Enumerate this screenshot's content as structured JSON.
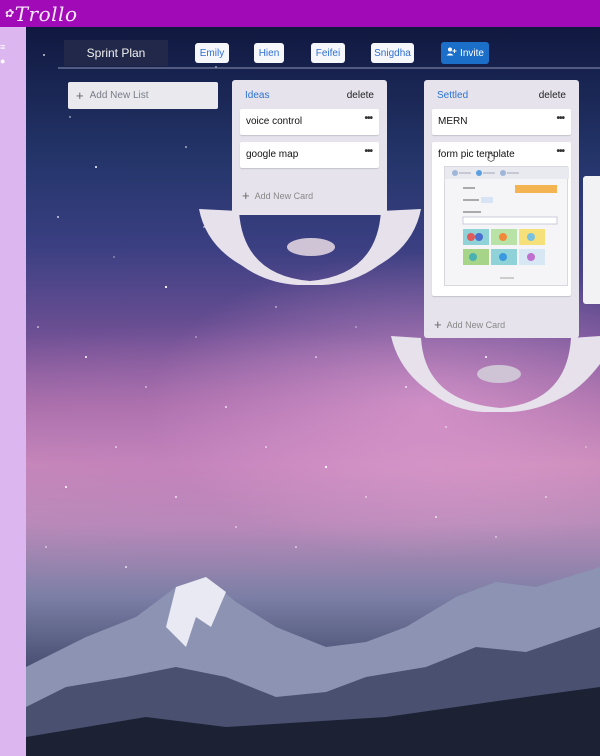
{
  "app": {
    "brand": "Trollo"
  },
  "board": {
    "title": "Sprint Plan",
    "members": [
      "Emily",
      "Hien",
      "Feifei",
      "Snigdha"
    ],
    "invite_label": "Invite",
    "add_list_label": "Add New List"
  },
  "lists": [
    {
      "title": "Ideas",
      "delete_label": "delete",
      "cards": [
        {
          "title": "voice control",
          "menu": "•••"
        },
        {
          "title": "google map",
          "menu": "•••"
        }
      ],
      "add_card_label": "Add New Card"
    },
    {
      "title": "Settled",
      "delete_label": "delete",
      "cards": [
        {
          "title": "MERN",
          "menu": "•••"
        },
        {
          "title": "form pic template",
          "menu": "•••"
        }
      ],
      "add_card_label": "Add New Card"
    }
  ],
  "colors": {
    "topbar": "#a10ab7",
    "sidebar": "#dcb6ee",
    "accent_blue": "#2c73d2",
    "invite_bg": "#1b6fc9"
  },
  "icons": [
    "plus-icon",
    "add-user-icon",
    "more-icon",
    "cursor-icon"
  ]
}
